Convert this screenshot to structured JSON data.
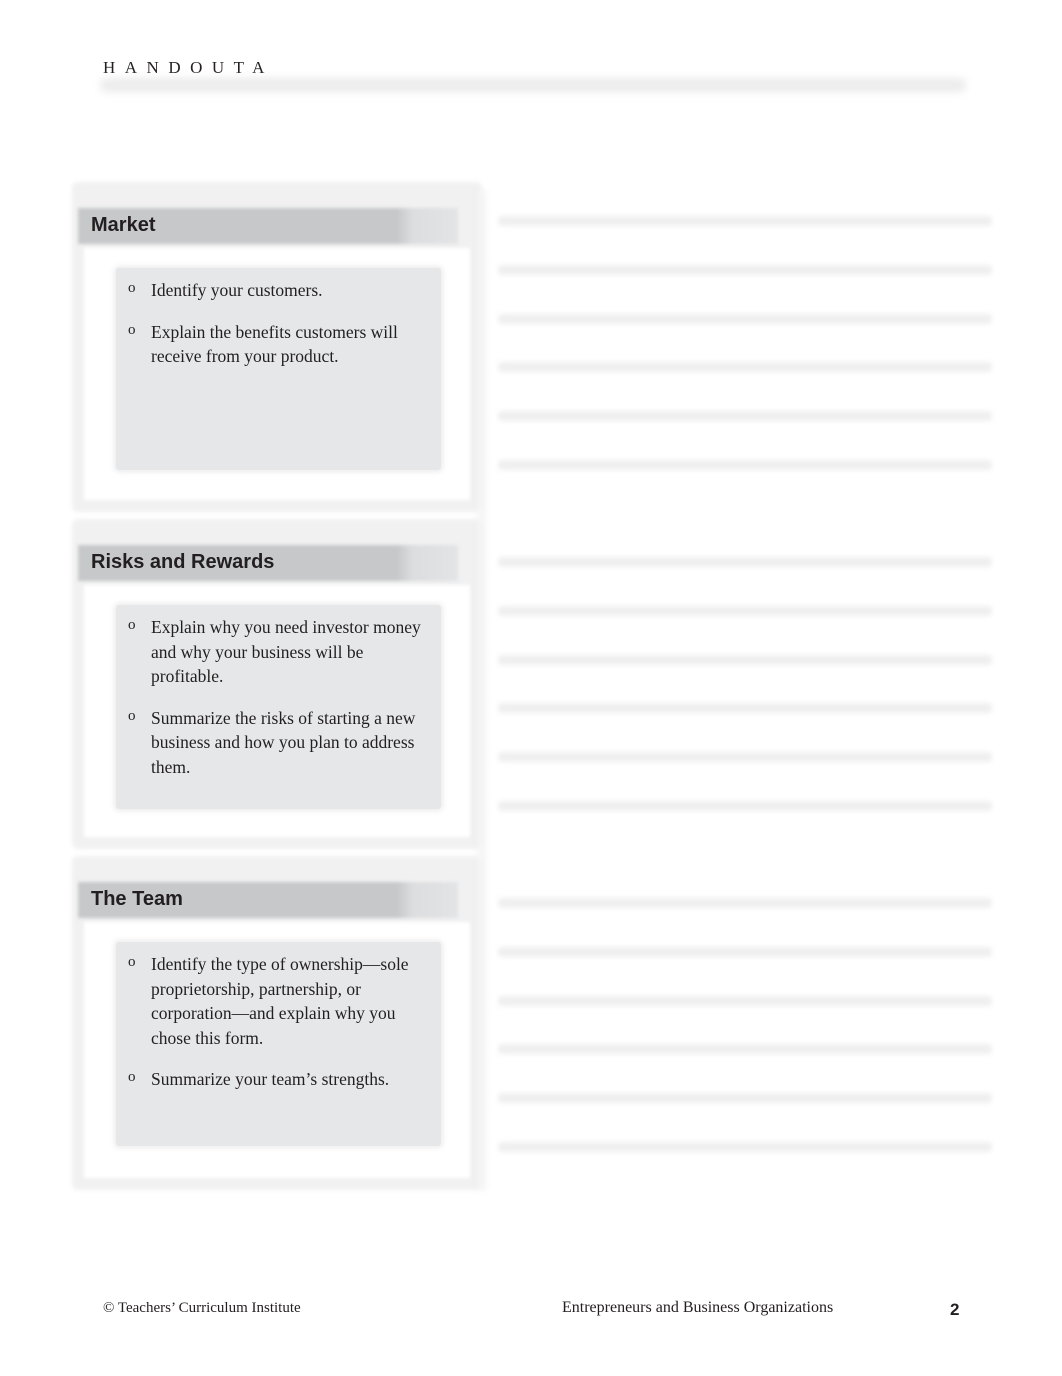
{
  "header": {
    "label": "HANDOUTA"
  },
  "sections": [
    {
      "title": "Market",
      "bullet_symbol": "o",
      "bullets": [
        "Identify your customers.",
        "Explain the benefits customers will receive from your product."
      ],
      "writing_lines": 6
    },
    {
      "title": "Risks and Rewards",
      "bullet_symbol": "o",
      "bullets": [
        "Explain why you need investor money and why your business will be profitable.",
        "Summarize the risks of starting a new business and how you plan to address them."
      ],
      "writing_lines": 6
    },
    {
      "title": "The Team",
      "bullet_symbol": "o",
      "bullets": [
        "Identify the type of ownership—sole proprietorship, partnership, or corporation—and explain why you chose this form.",
        "Summarize your team’s strengths."
      ],
      "writing_lines": 6
    }
  ],
  "footer": {
    "copyright": "© Teachers’ Curriculum Institute",
    "book_title": "Entrepreneurs and Business Organizations",
    "page_number": "2"
  },
  "colors": {
    "title_bar": "#c6c8ca",
    "prompt_box": "#e5e7e8",
    "text": "#231f20"
  }
}
